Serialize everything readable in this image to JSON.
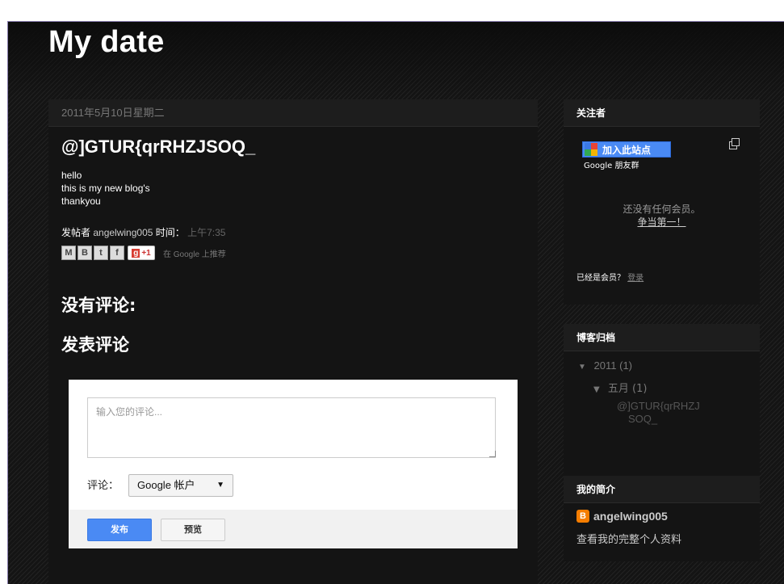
{
  "blog": {
    "title": "My date"
  },
  "post": {
    "date": "2011年5月10日星期二",
    "title": "@]GTUR{qrRHZJSOQ_",
    "body_lines": [
      "hello",
      "this is my new blog's",
      "thankyou"
    ],
    "posted_by_label": "发帖者",
    "author": "angelwing005",
    "time_label": "时间：",
    "time": "上午7:35",
    "share": {
      "email": "M",
      "blog": "B",
      "twitter": "t",
      "facebook": "f",
      "plusone_g": "g",
      "plusone_count": "+1",
      "recommend_text": "在 Google 上推荐"
    },
    "no_comments": "没有评论:",
    "post_comment_heading": "发表评论"
  },
  "comment_form": {
    "placeholder": "输入您的评论...",
    "comment_as_label": "评论：",
    "account_select": "Google 帐户",
    "publish_label": "发布",
    "preview_label": "预览"
  },
  "followers_widget": {
    "title": "关注者",
    "join_label": "加入此站点",
    "gfc_label": "Google 朋友群",
    "no_members_line1": "还没有任何会员。",
    "no_members_line2": "争当第一！",
    "already_member": "已经是会员？",
    "login_link": "登录"
  },
  "archive_widget": {
    "title": "博客归档",
    "year": "2011",
    "year_count": "(1)",
    "month": "五月",
    "month_count": "(1)",
    "post_title_lines": [
      "@]GTUR{qrRHZJ",
      "SOQ_"
    ]
  },
  "profile_widget": {
    "title": "我的简介",
    "name": "angelwing005",
    "view_profile": "查看我的完整个人资料"
  },
  "colors": {
    "background": "#141414",
    "accent_blue": "#4a8af4",
    "blogger_orange": "#f57d00"
  }
}
